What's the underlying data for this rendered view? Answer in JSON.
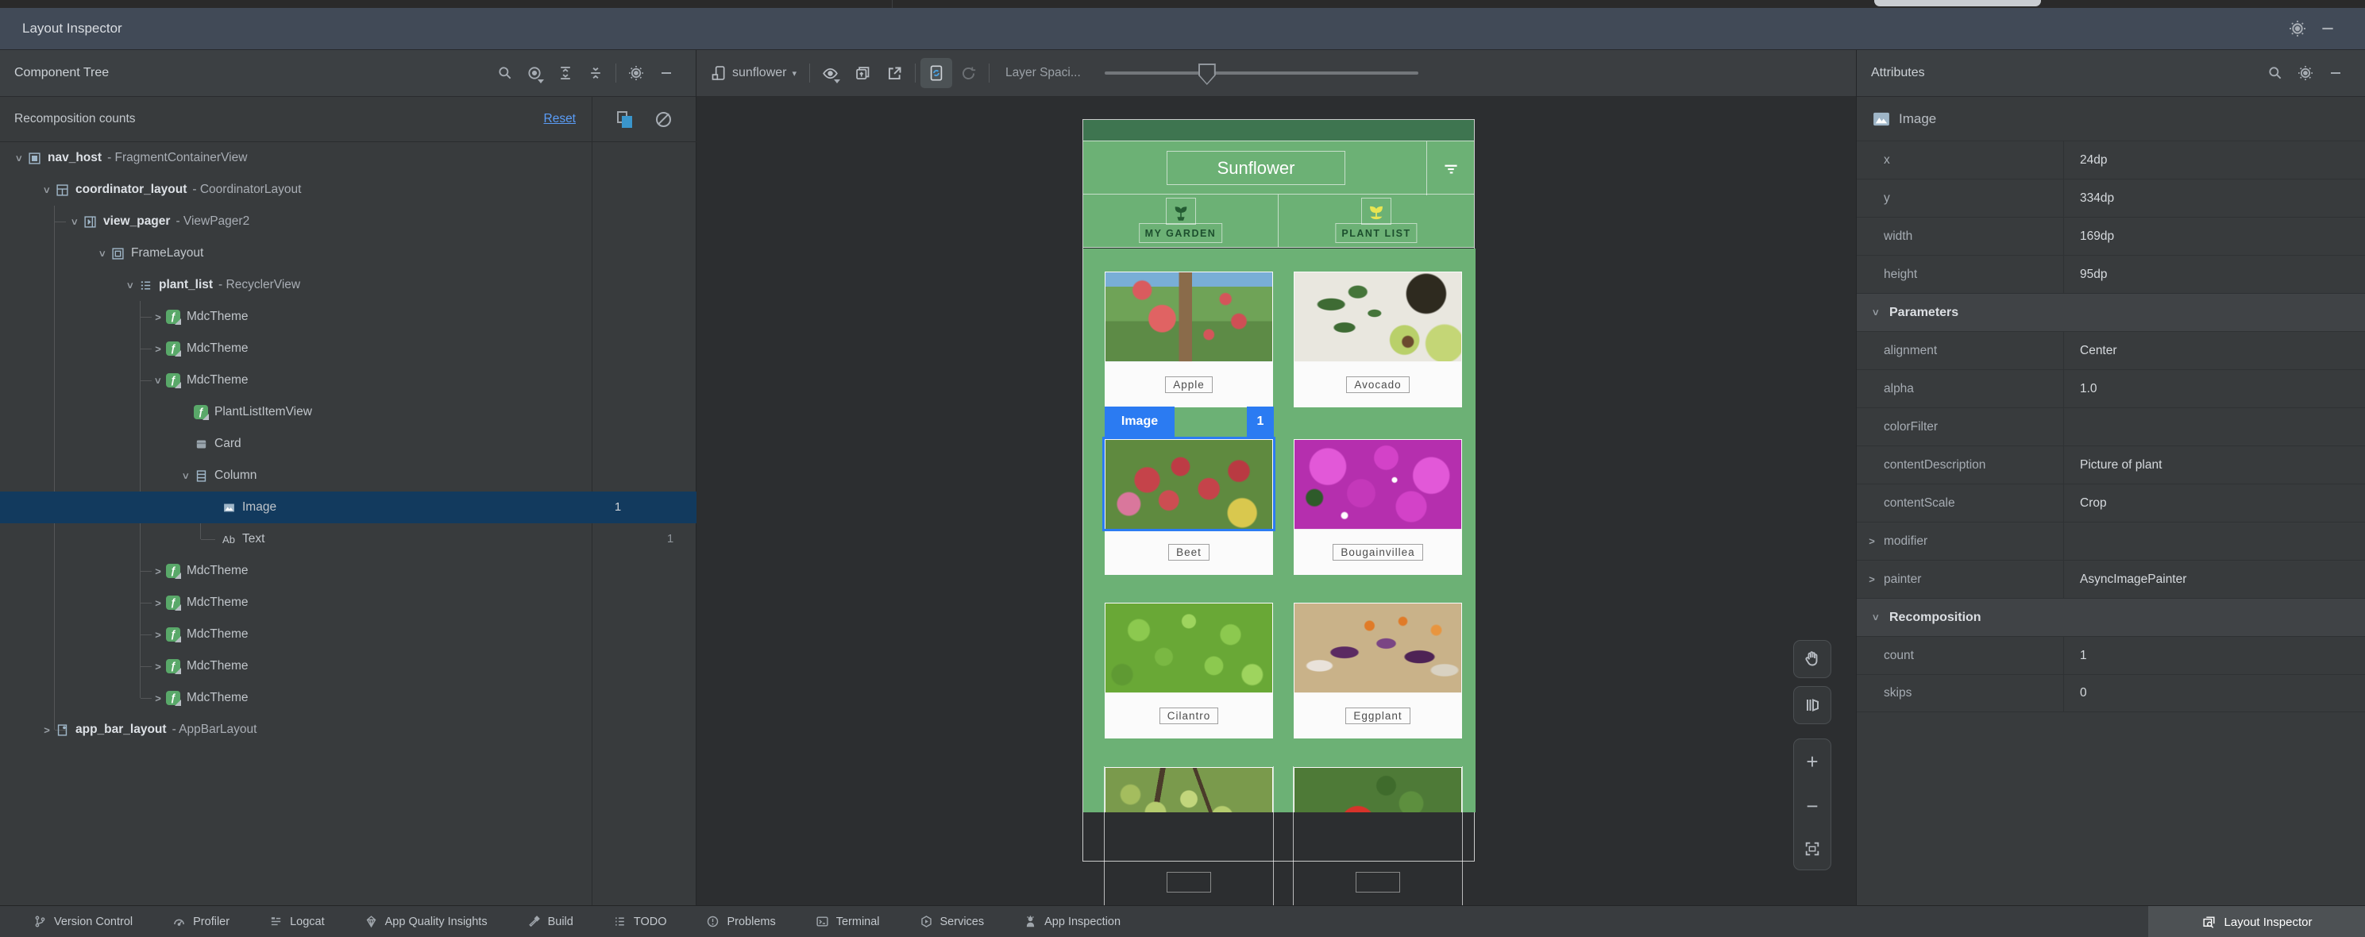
{
  "window": {
    "title": "Layout Inspector"
  },
  "icons": {
    "search-icon": "magnifier",
    "gear-icon": "settings gear",
    "minimize-icon": "hide panel",
    "visibility-icon": "view options eye",
    "expand-all-icon": "expand nodes",
    "collapse-all-icon": "collapse nodes",
    "recomposition-highlight-icon": "blue highlight stack",
    "clear-counts-icon": "slashed circle",
    "device-icon": "phone",
    "chevron-down-icon": "dropdown caret",
    "snapshot-icon": "export snapshot",
    "popout-icon": "open in new window",
    "live-updates-icon": "phone with sync arrows",
    "refresh-icon": "reload",
    "pan-icon": "hand",
    "rotation-icon": "3d layer rotation",
    "zoom-in-icon": "plus",
    "zoom-out-icon": "minus",
    "zoom-fit-icon": "fit corners",
    "filter-icon": "filter lines",
    "my-garden-icon": "potted plant sprout",
    "plant-list-icon": "yellow seedling",
    "image-icon": "picture with mountains"
  },
  "component_tree": {
    "header": "Component Tree",
    "recomposition_label": "Recomposition counts",
    "reset_label": "Reset",
    "items": [
      {
        "id": "nav_host",
        "type": "- FragmentContainerView"
      },
      {
        "id": "coordinator_layout",
        "type": "- CoordinatorLayout"
      },
      {
        "id": "view_pager",
        "type": "- ViewPager2"
      },
      {
        "id": "",
        "type": "FrameLayout"
      },
      {
        "id": "plant_list",
        "type": "- RecyclerView"
      },
      {
        "id": "",
        "type": "MdcTheme"
      },
      {
        "id": "",
        "type": "MdcTheme"
      },
      {
        "id": "",
        "type": "MdcTheme"
      },
      {
        "id": "",
        "type": "PlantListItemView"
      },
      {
        "id": "",
        "type": "Card"
      },
      {
        "id": "",
        "type": "Column"
      },
      {
        "id": "",
        "type": "Image",
        "count": "1"
      },
      {
        "id": "",
        "type": "Text",
        "skips": "1"
      },
      {
        "id": "",
        "type": "MdcTheme"
      },
      {
        "id": "",
        "type": "MdcTheme"
      },
      {
        "id": "",
        "type": "MdcTheme"
      },
      {
        "id": "",
        "type": "MdcTheme"
      },
      {
        "id": "",
        "type": "MdcTheme"
      },
      {
        "id": "app_bar_layout",
        "type": "- AppBarLayout"
      }
    ]
  },
  "toolbar": {
    "process": "sunflower",
    "layer_spacing_label": "Layer Spaci..."
  },
  "device": {
    "app_title": "Sunflower",
    "tabs": [
      "MY GARDEN",
      "PLANT LIST"
    ],
    "plants": [
      "Apple",
      "Avocado",
      "Beet",
      "Bougainvillea",
      "Cilantro",
      "Eggplant"
    ],
    "selection_tag": "Image",
    "selection_badge": "1"
  },
  "attributes": {
    "header": "Attributes",
    "component": "Image",
    "geometry": [
      {
        "k": "x",
        "v": "24dp"
      },
      {
        "k": "y",
        "v": "334dp"
      },
      {
        "k": "width",
        "v": "169dp"
      },
      {
        "k": "height",
        "v": "95dp"
      }
    ],
    "parameters_title": "Parameters",
    "parameters": [
      {
        "k": "alignment",
        "v": "Center"
      },
      {
        "k": "alpha",
        "v": "1.0"
      },
      {
        "k": "colorFilter",
        "v": ""
      },
      {
        "k": "contentDescription",
        "v": "Picture of plant"
      },
      {
        "k": "contentScale",
        "v": "Crop"
      },
      {
        "k": "modifier",
        "v": ""
      },
      {
        "k": "painter",
        "v": "AsyncImagePainter"
      }
    ],
    "recomposition_title": "Recomposition",
    "recomposition": [
      {
        "k": "count",
        "v": "1"
      },
      {
        "k": "skips",
        "v": "0"
      }
    ]
  },
  "status_bar": {
    "items": [
      "Version Control",
      "Profiler",
      "Logcat",
      "App Quality Insights",
      "Build",
      "TODO",
      "Problems",
      "Terminal",
      "Services",
      "App Inspection"
    ],
    "active": "Layout Inspector"
  }
}
